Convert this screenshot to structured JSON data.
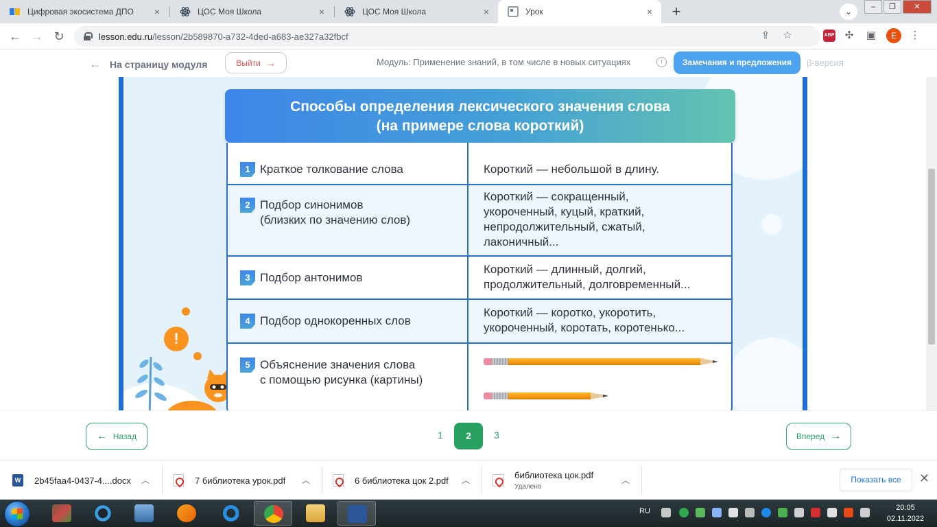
{
  "browser": {
    "tabs": [
      {
        "title": "Цифровая экосистема ДПО"
      },
      {
        "title": "ЦОС Моя Школа"
      },
      {
        "title": "ЦОС Моя Школа"
      },
      {
        "title": "Урок"
      }
    ],
    "url_host": "lesson.edu.ru",
    "url_path": "/lesson/2b589870-a732-4ded-a683-ae327a32fbcf",
    "profile_letter": "E",
    "abp_label": "ABP"
  },
  "lesson_header": {
    "back_label": "На страницу модуля",
    "exit_label": "Выйти",
    "module_text": "Модуль: Применение знаний, в том числе в новых ситуациях",
    "feedback_label": "Замечания и предложения",
    "beta_label": "β-версия"
  },
  "slide": {
    "title_line1": "Способы определения лексического значения слова",
    "title_line2": "(на примере слова короткий)",
    "rows": [
      {
        "num": "1",
        "left": [
          "Краткое толкование слова"
        ],
        "right": [
          "Короткий — небольшой в длину."
        ]
      },
      {
        "num": "2",
        "left": [
          "Подбор синонимов",
          "(близких по значению слов)"
        ],
        "right": [
          "Короткий — сокращенный,",
          "укороченный, куцый, краткий,",
          "непродолжительный, сжатый,",
          "лаконичный..."
        ]
      },
      {
        "num": "3",
        "left": [
          "Подбор антонимов"
        ],
        "right": [
          "Короткий — длинный, долгий,",
          "продолжительный, долговременный..."
        ]
      },
      {
        "num": "4",
        "left": [
          "Подбор однокоренных слов"
        ],
        "right": [
          "Короткий — коротко, укоротить,",
          "укороченный, коротать, коротенько..."
        ]
      },
      {
        "num": "5",
        "left": [
          "Объяснение значения слова",
          "с помощью рисунка (картины)"
        ],
        "right": []
      }
    ],
    "alert_symbol": "!"
  },
  "pager": {
    "prev_label": "Назад",
    "next_label": "Вперед",
    "pages": [
      "1",
      "2",
      "3"
    ],
    "current": "2"
  },
  "downloads": {
    "items": [
      {
        "name": "2b45faa4-0437-4....docx",
        "type": "word",
        "status": ""
      },
      {
        "name": "7 библиотека урок.pdf",
        "type": "pdf",
        "status": ""
      },
      {
        "name": "6 библиотека цок 2.pdf",
        "type": "pdf",
        "status": ""
      },
      {
        "name": "библиотека цок.pdf",
        "type": "pdf",
        "status": "Удалено"
      }
    ],
    "show_all_label": "Показать все"
  },
  "taskbar": {
    "lang": "RU",
    "time": "20:05",
    "date": "02.11.2022"
  }
}
